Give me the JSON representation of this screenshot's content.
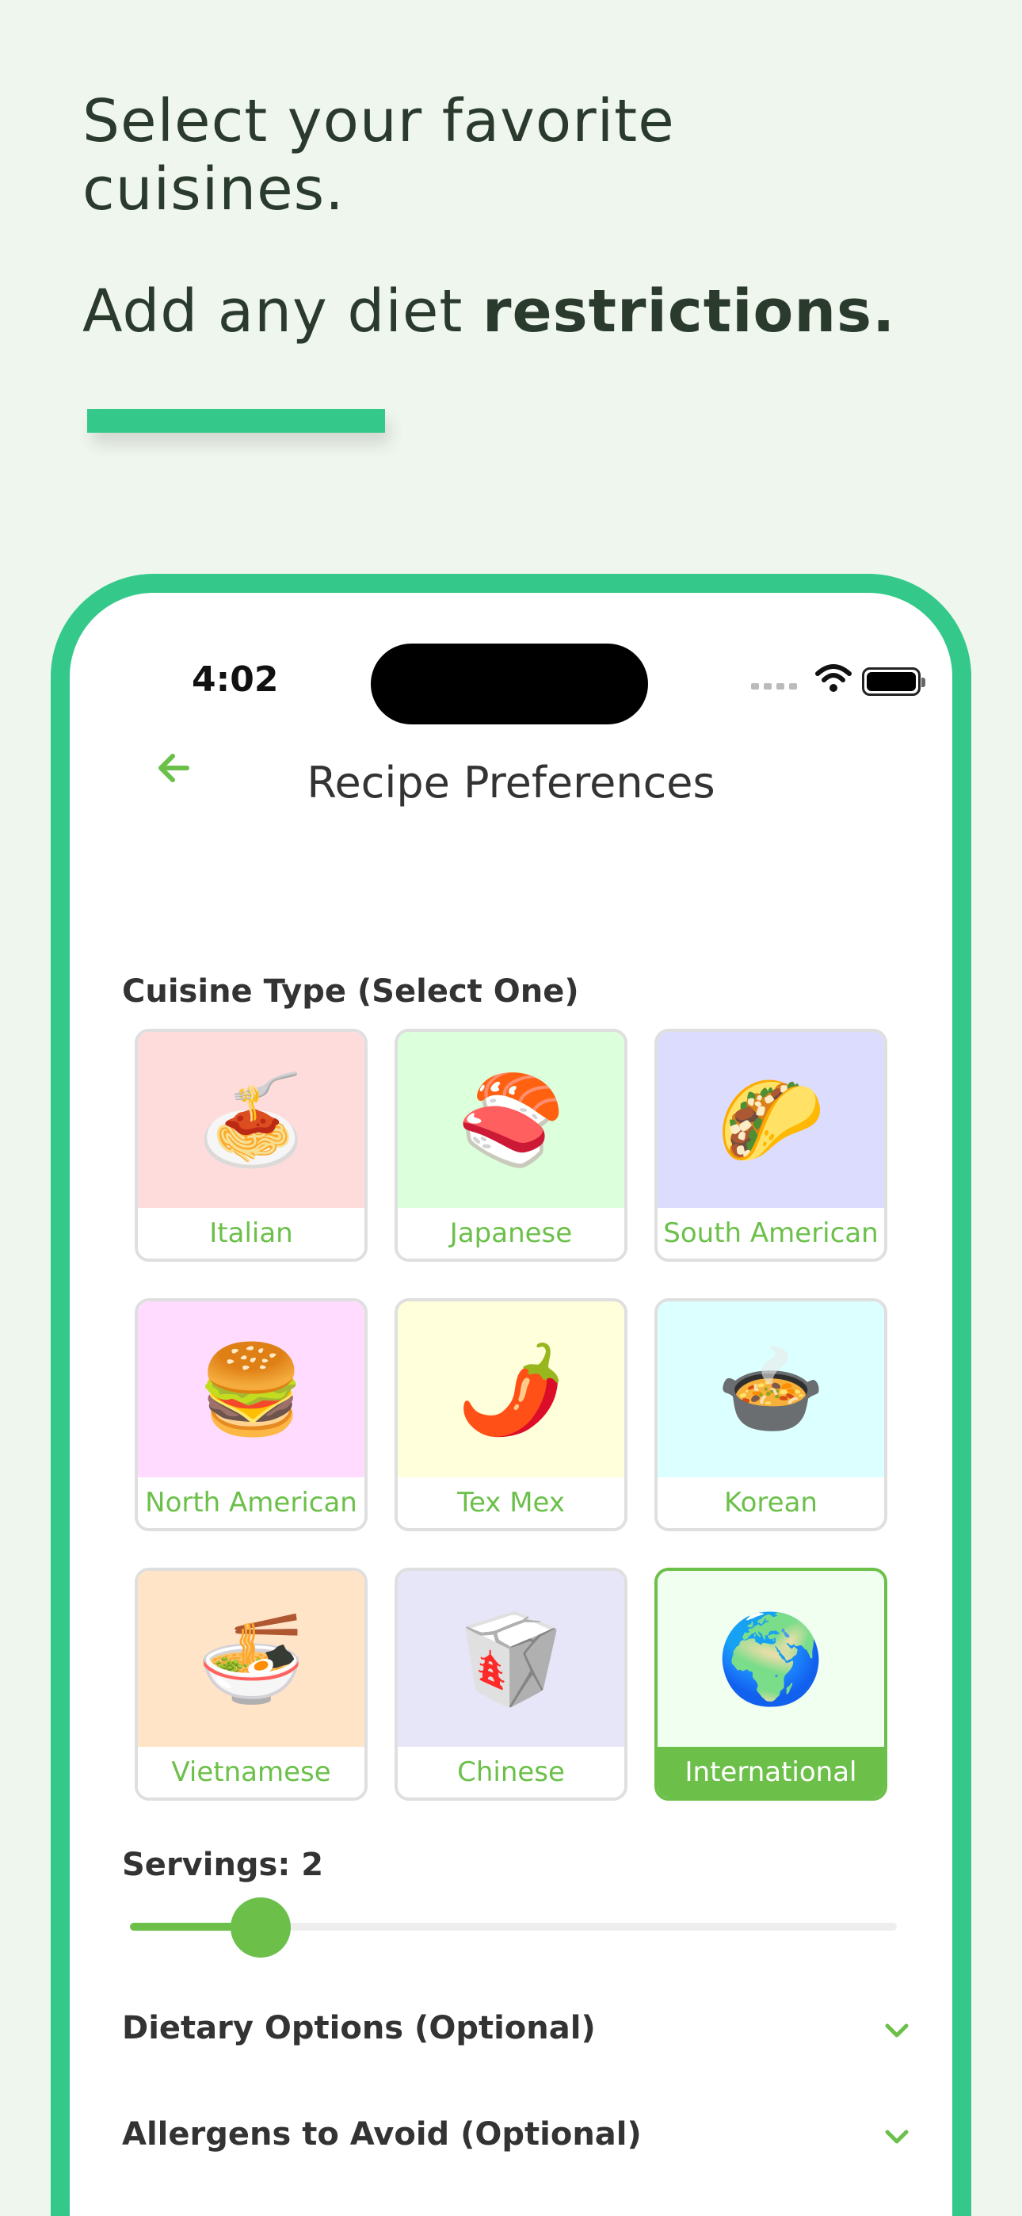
{
  "marketing": {
    "line1": "Select your favorite cuisines.",
    "line2_prefix": "Add any diet ",
    "line2_bold": "restrictions."
  },
  "status_bar": {
    "time": "4:02"
  },
  "nav": {
    "title": "Recipe Preferences"
  },
  "cuisine_section": {
    "title": "Cuisine Type (Select One)",
    "items": [
      {
        "label": "Italian",
        "emoji": "🍝",
        "bg": "#ffdcdc",
        "selected": false
      },
      {
        "label": "Japanese",
        "emoji": "🍣",
        "bg": "#dcffdc",
        "selected": false
      },
      {
        "label": "South American",
        "emoji": "🌮",
        "bg": "#dcdcff",
        "selected": false
      },
      {
        "label": "North American",
        "emoji": "🍔",
        "bg": "#ffdcff",
        "selected": false
      },
      {
        "label": "Tex Mex",
        "emoji": "🌶️",
        "bg": "#ffffdc",
        "selected": false
      },
      {
        "label": "Korean",
        "emoji": "🍲",
        "bg": "#dcffff",
        "selected": false
      },
      {
        "label": "Vietnamese",
        "emoji": "🍜",
        "bg": "#ffe4c8",
        "selected": false
      },
      {
        "label": "Chinese",
        "emoji": "🥡",
        "bg": "#e6e6f8",
        "selected": false
      },
      {
        "label": "International",
        "emoji": "🌍",
        "bg": "#f0fff0",
        "selected": true
      }
    ]
  },
  "servings": {
    "label": "Servings: 2",
    "value": 2,
    "fraction": 0.17
  },
  "accordions": {
    "dietary": "Dietary Options (Optional)",
    "allergens": "Allergens to Avoid (Optional)"
  },
  "colors": {
    "accent": "#34c98a",
    "green": "#6cc04a",
    "background": "#eff6ee"
  }
}
